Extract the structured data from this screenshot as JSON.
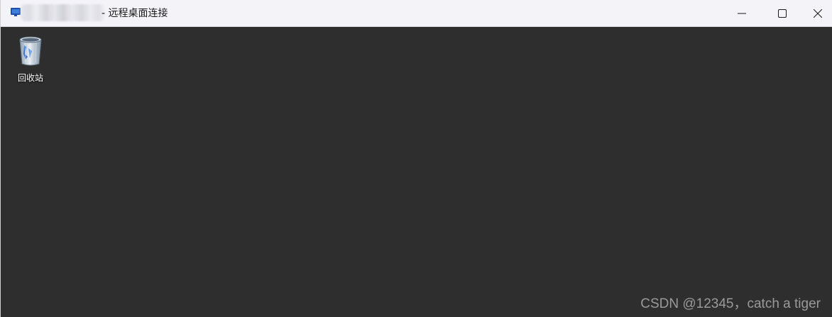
{
  "window": {
    "title": "- 远程桌面连接",
    "controls": {
      "minimize_icon": "minimize-icon",
      "maximize_icon": "maximize-icon",
      "close_icon": "close-icon"
    }
  },
  "desktop": {
    "background_color": "#2e2e2e",
    "icons": [
      {
        "label": "回收站",
        "icon": "recycle-bin-icon"
      }
    ]
  },
  "watermark": {
    "text": "CSDN @12345，catch a tiger"
  }
}
